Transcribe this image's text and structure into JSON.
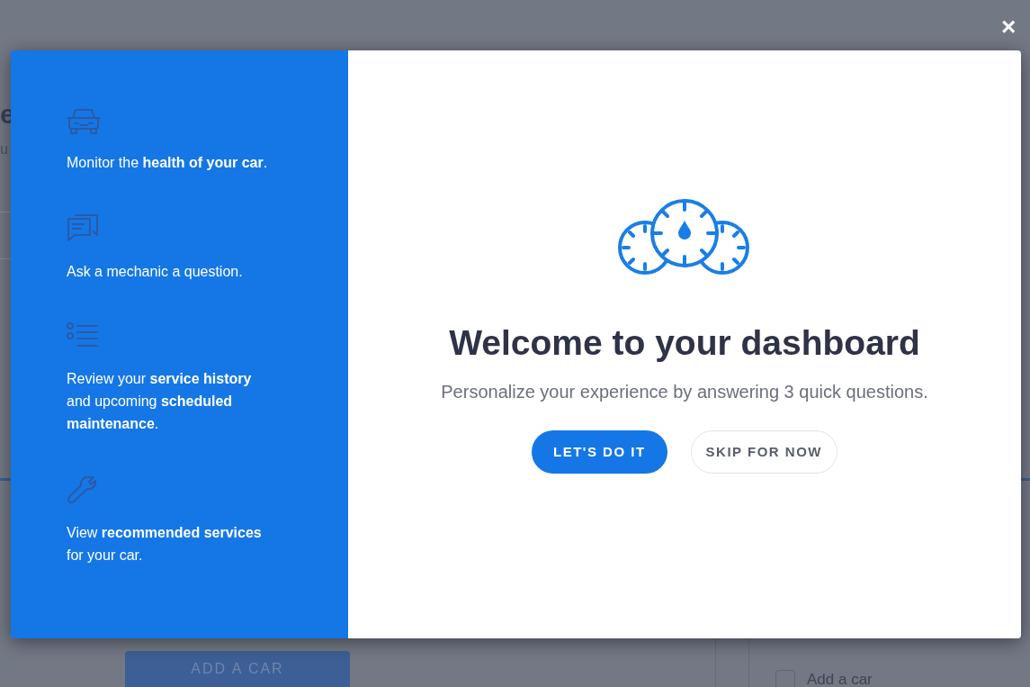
{
  "background": {
    "heading_fragment": "e",
    "subheading_fragment": "u",
    "add_car_button": "ADD A CAR",
    "checklist": [
      {
        "label": "Add a car",
        "checked": false
      }
    ]
  },
  "close_button": "×",
  "features": [
    {
      "text": "Monitor the **health of your car**."
    },
    {
      "text": "Ask a mechanic a question."
    },
    {
      "text": "Review your **service history** and upcoming **scheduled maintenance**."
    },
    {
      "text": "View **recommended services** for your car."
    }
  ],
  "welcome": {
    "title": "Welcome to your dashboard",
    "subtitle": "Personalize your experience by answering 3 quick questions.",
    "buttons": [
      {
        "label": "LET'S DO IT",
        "kind": "primary"
      },
      {
        "label": "SKIP FOR NOW",
        "kind": "secondary"
      }
    ]
  }
}
